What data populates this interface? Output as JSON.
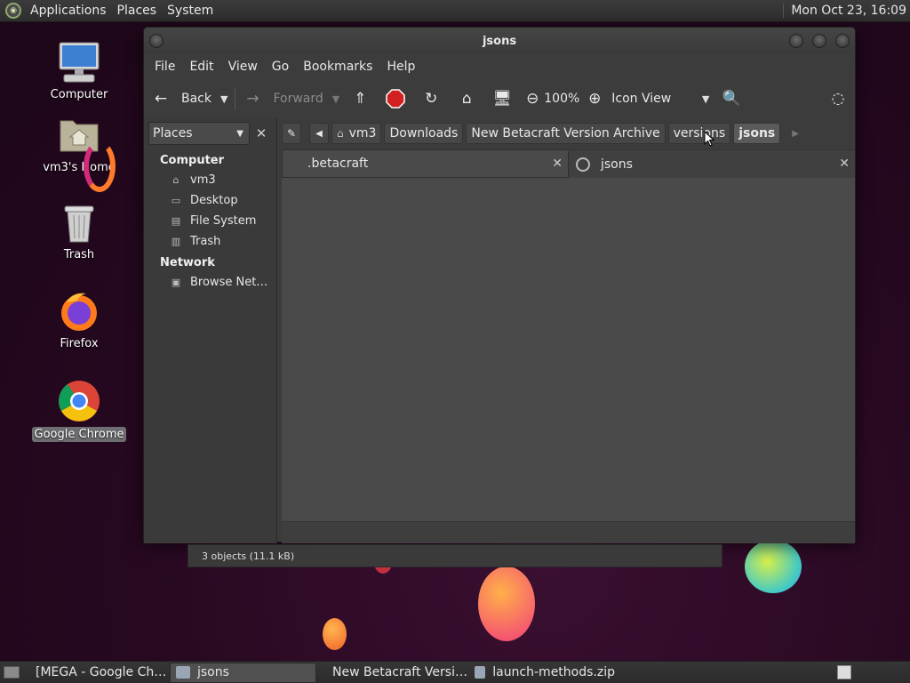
{
  "top_panel": {
    "menus": [
      "Applications",
      "Places",
      "System"
    ],
    "clock": "Mon Oct 23, 16:09"
  },
  "desktop_icons": [
    {
      "label": "Computer",
      "icon": "computer-icon"
    },
    {
      "label": "vm3's Home",
      "icon": "home-folder-icon"
    },
    {
      "label": "Trash",
      "icon": "trash-icon"
    },
    {
      "label": "Firefox",
      "icon": "firefox-icon"
    },
    {
      "label": "Google Chrome",
      "icon": "chrome-icon"
    }
  ],
  "window": {
    "title": "jsons",
    "menubar": [
      "File",
      "Edit",
      "View",
      "Go",
      "Bookmarks",
      "Help"
    ],
    "toolbar": {
      "back": "Back",
      "forward": "Forward",
      "zoom": "100%",
      "view_mode": "Icon View"
    },
    "sidebar": {
      "selector": "Places",
      "sections": [
        {
          "heading": "Computer",
          "items": [
            "vm3",
            "Desktop",
            "File System",
            "Trash"
          ]
        },
        {
          "heading": "Network",
          "items": [
            "Browse Net…"
          ]
        }
      ]
    },
    "pathbar": [
      "vm3",
      "Downloads",
      "New Betacraft Version Archive",
      "versions",
      "jsons"
    ],
    "tabs": [
      {
        "label": ".betacraft",
        "active": true
      },
      {
        "label": "jsons",
        "active": false
      }
    ],
    "status": "3 objects (11.1 kB)"
  },
  "taskbar": [
    {
      "label": "[MEGA - Google Ch…",
      "active": false
    },
    {
      "label": "jsons",
      "active": true
    },
    {
      "label": "New Betacraft Versi…",
      "active": false
    },
    {
      "label": "launch-methods.zip",
      "active": false
    }
  ]
}
